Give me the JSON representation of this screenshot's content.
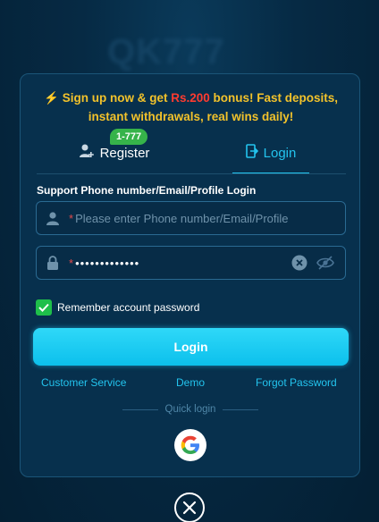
{
  "backdrop": {
    "logo_text": "QK777"
  },
  "promo": {
    "line1_pre": "Sign up now & get ",
    "line1_highlight": "Rs.200",
    "line1_post": " bonus! Fast deposits,",
    "line2": "instant withdrawals, real wins daily!"
  },
  "tabs": {
    "register": {
      "label": "Register",
      "badge": "1-777"
    },
    "login": {
      "label": "Login",
      "active": true
    }
  },
  "form": {
    "label": "Support Phone number/Email/Profile Login",
    "account_placeholder": "Please enter Phone number/Email/Profile",
    "password_mask": "•••••••••••••",
    "remember_label": "Remember account password",
    "remember_checked": true,
    "submit_label": "Login"
  },
  "links": {
    "customer_service": "Customer Service",
    "demo": "Demo",
    "forgot_password": "Forgot Password"
  },
  "quick_login": {
    "label": "Quick login",
    "provider_icon": "google-icon"
  },
  "colors": {
    "accent": "#23c4ee",
    "promo_text": "#f2c22b",
    "promo_highlight": "#ff3b30",
    "badge": "#36b34a",
    "checkbox": "#1fbf4a",
    "modal_bg": "#07304d"
  }
}
